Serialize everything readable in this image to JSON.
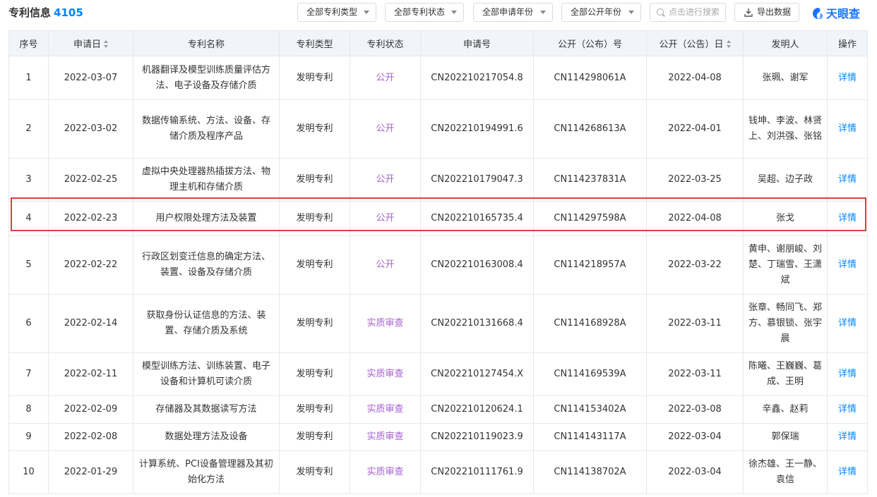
{
  "header": {
    "title": "专利信息",
    "count": "4105",
    "filters": [
      "全部专利类型",
      "全部专利状态",
      "全部申请年份",
      "全部公开年份"
    ],
    "search_placeholder": "点击进行搜索",
    "export_label": "导出数据",
    "logo_text": "天眼查"
  },
  "colors": {
    "accent": "#0084ff",
    "status_purple": "#a560d1",
    "highlight_red": "#e03d3d",
    "header_bg": "#f1f5fb"
  },
  "table": {
    "columns": [
      "序号",
      "申请日",
      "专利名称",
      "专利类型",
      "专利状态",
      "申请号",
      "公开（公布）号",
      "公开（公告）日",
      "发明人",
      "操作"
    ],
    "rows": [
      {
        "no": "1",
        "date": "2022-03-07",
        "name": "机器翻译及模型训练质量评估方法、电子设备及存储介质",
        "type": "发明专利",
        "status": "公开",
        "app_no": "CN202210217054.8",
        "pub_no": "CN114298061A",
        "pub_date": "2022-04-08",
        "inventors": "张珮、谢军",
        "op": "详情"
      },
      {
        "no": "2",
        "date": "2022-03-02",
        "name": "数据传输系统、方法、设备、存储介质及程序产品",
        "type": "发明专利",
        "status": "公开",
        "app_no": "CN202210194991.6",
        "pub_no": "CN114268613A",
        "pub_date": "2022-04-01",
        "inventors": "钱坤、李波、林贤上、刘洪强、张铭",
        "op": "详情"
      },
      {
        "no": "3",
        "date": "2022-02-25",
        "name": "虚拟中央处理器热插拔方法、物理主机和存储介质",
        "type": "发明专利",
        "status": "公开",
        "app_no": "CN202210179047.3",
        "pub_no": "CN114237831A",
        "pub_date": "2022-03-25",
        "inventors": "吴超、边子政",
        "op": "详情"
      },
      {
        "no": "4",
        "date": "2022-02-23",
        "name": "用户权限处理方法及装置",
        "type": "发明专利",
        "status": "公开",
        "app_no": "CN202210165735.4",
        "pub_no": "CN114297598A",
        "pub_date": "2022-04-08",
        "inventors": "张戈",
        "op": "详情"
      },
      {
        "no": "5",
        "date": "2022-02-22",
        "name": "行政区划变迁信息的确定方法、装置、设备及存储介质",
        "type": "发明专利",
        "status": "公开",
        "app_no": "CN202210163008.4",
        "pub_no": "CN114218957A",
        "pub_date": "2022-03-22",
        "inventors": "黄申、谢朋峻、刘楚、丁瑞雪、王潇斌",
        "op": "详情"
      },
      {
        "no": "6",
        "date": "2022-02-14",
        "name": "获取身份认证信息的方法、装置、存储介质及系统",
        "type": "发明专利",
        "status": "实质审查",
        "app_no": "CN202210131668.4",
        "pub_no": "CN114168928A",
        "pub_date": "2022-03-11",
        "inventors": "张章、畅同飞、郑方、慕银锁、张宇晨",
        "op": "详情"
      },
      {
        "no": "7",
        "date": "2022-02-11",
        "name": "模型训练方法、训练装置、电子设备和计算机可读介质",
        "type": "发明专利",
        "status": "实质审查",
        "app_no": "CN202210127454.X",
        "pub_no": "CN114169539A",
        "pub_date": "2022-03-11",
        "inventors": "陈曦、王巍巍、葛成、王明",
        "op": "详情"
      },
      {
        "no": "8",
        "date": "2022-02-09",
        "name": "存储器及其数据读写方法",
        "type": "发明专利",
        "status": "实质审查",
        "app_no": "CN202210120624.1",
        "pub_no": "CN114153402A",
        "pub_date": "2022-03-08",
        "inventors": "辛鑫、赵莉",
        "op": "详情"
      },
      {
        "no": "9",
        "date": "2022-02-08",
        "name": "数据处理方法及设备",
        "type": "发明专利",
        "status": "实质审查",
        "app_no": "CN202210119023.9",
        "pub_no": "CN114143117A",
        "pub_date": "2022-03-04",
        "inventors": "郭保瑞",
        "op": "详情"
      },
      {
        "no": "10",
        "date": "2022-01-29",
        "name": "计算系统、PCI设备管理器及其初始化方法",
        "type": "发明专利",
        "status": "实质审查",
        "app_no": "CN202210111761.9",
        "pub_no": "CN114138702A",
        "pub_date": "2022-03-04",
        "inventors": "徐杰雄、王一静、袁信",
        "op": "详情"
      }
    ]
  }
}
